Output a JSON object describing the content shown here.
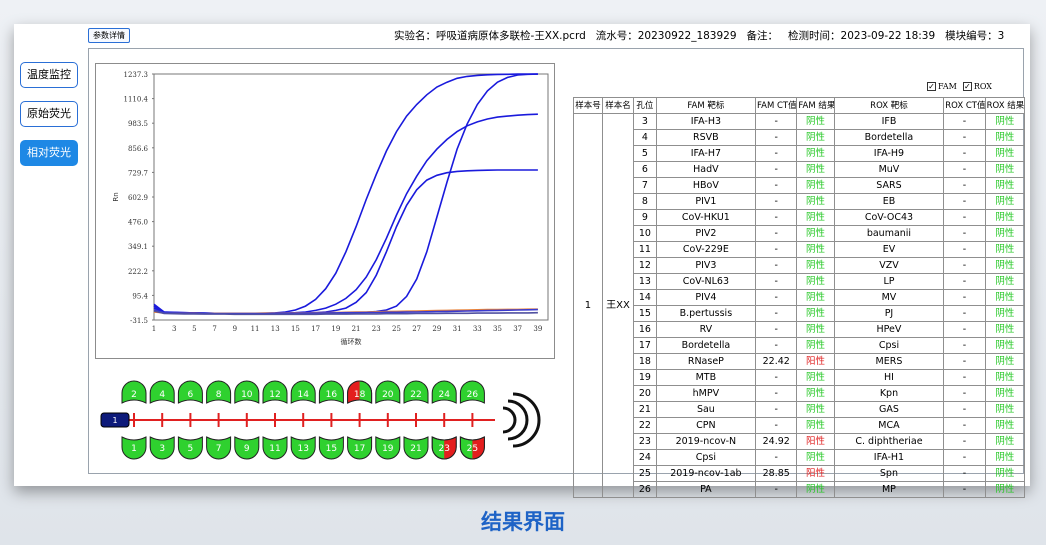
{
  "sidebar": {
    "items": [
      {
        "label": "温度监控",
        "active": false
      },
      {
        "label": "原始荧光",
        "active": false
      },
      {
        "label": "相对荧光",
        "active": true
      }
    ]
  },
  "param_button": "参数详情",
  "header": {
    "experiment": "实验名：呼吸道病原体多联检-王XX.pcrd",
    "serial": "流水号：20230922_183929",
    "note": "备注：",
    "time": "检测时间：2023-09-22 18:39",
    "module": "模块编号：3"
  },
  "checks": [
    {
      "label": "FAM",
      "checked": true
    },
    {
      "label": "ROX",
      "checked": true
    }
  ],
  "chart_data": {
    "type": "line",
    "title": "",
    "xlabel": "循环数",
    "ylabel": "Rn",
    "yticks": [
      "1237.3",
      "1110.4",
      "983.5",
      "856.6",
      "729.7",
      "602.9",
      "476.0",
      "349.1",
      "222.2",
      "95.4",
      "-31.5"
    ],
    "xticks": [
      "1",
      "3",
      "5",
      "7",
      "9",
      "11",
      "13",
      "15",
      "17",
      "19",
      "21",
      "23",
      "25",
      "27",
      "29",
      "31",
      "33",
      "35",
      "37",
      "39"
    ],
    "xlim": [
      1,
      40
    ],
    "ylim": [
      -31.5,
      1237.3
    ],
    "series": [
      {
        "color": "#1a1adc",
        "values": [
          50,
          10,
          8,
          6,
          5,
          4,
          3,
          3,
          2,
          2,
          2,
          3,
          5,
          10,
          20,
          40,
          75,
          130,
          210,
          320,
          450,
          590,
          720,
          840,
          940,
          1020,
          1080,
          1130,
          1170,
          1195,
          1215,
          1225,
          1230,
          1233,
          1235,
          1236,
          1237,
          1237,
          1237
        ]
      },
      {
        "color": "#1a1adc",
        "values": [
          30,
          8,
          6,
          5,
          4,
          3,
          3,
          2,
          2,
          2,
          2,
          2,
          3,
          4,
          6,
          10,
          18,
          30,
          50,
          80,
          125,
          190,
          280,
          390,
          510,
          620,
          710,
          790,
          850,
          900,
          940,
          970,
          990,
          1005,
          1015,
          1020,
          1025,
          1028,
          1030
        ]
      },
      {
        "color": "#1a1adc",
        "values": [
          40,
          8,
          6,
          5,
          4,
          3,
          3,
          2,
          2,
          2,
          2,
          2,
          2,
          3,
          3,
          4,
          6,
          10,
          18,
          30,
          60,
          110,
          200,
          320,
          450,
          560,
          640,
          690,
          715,
          728,
          735,
          738,
          740,
          741,
          742,
          742,
          742,
          742,
          742
        ]
      },
      {
        "color": "#1a1adc",
        "values": [
          40,
          9,
          7,
          6,
          5,
          4,
          3,
          2,
          2,
          2,
          2,
          2,
          2,
          2,
          3,
          3,
          3,
          4,
          4,
          5,
          6,
          8,
          12,
          20,
          40,
          90,
          180,
          320,
          500,
          680,
          850,
          980,
          1080,
          1150,
          1195,
          1220,
          1232,
          1236,
          1237
        ]
      },
      {
        "color": "#e8833a",
        "values": [
          10,
          5,
          4,
          4,
          4,
          3,
          3,
          3,
          3,
          3,
          3,
          4,
          4,
          4,
          5,
          5,
          6,
          6,
          7,
          8,
          9,
          10,
          11,
          12,
          13,
          14,
          15,
          16,
          17,
          18,
          19,
          20,
          21,
          22,
          22,
          23,
          23,
          24,
          24
        ]
      },
      {
        "color": "#3a3ad0",
        "values": [
          20,
          6,
          5,
          4,
          3,
          3,
          2,
          2,
          2,
          2,
          2,
          2,
          3,
          3,
          3,
          4,
          4,
          5,
          5,
          6,
          6,
          7,
          7,
          8,
          8,
          9,
          10,
          11,
          12,
          13,
          14,
          15,
          16,
          17,
          18,
          19,
          20,
          21,
          22
        ]
      },
      {
        "color": "#5050a0",
        "values": [
          15,
          2,
          1,
          0,
          0,
          -1,
          -1,
          -1,
          -2,
          -2,
          -2,
          -2,
          -2,
          -2,
          -2,
          -2,
          -2,
          -1,
          -1,
          -1,
          0,
          0,
          0,
          1,
          1,
          1,
          2,
          2,
          2,
          3,
          3,
          3,
          4,
          4,
          4,
          5,
          5,
          5,
          6
        ]
      }
    ]
  },
  "plate": {
    "strip_label": "1",
    "top_wells": [
      {
        "n": "2",
        "state": "green"
      },
      {
        "n": "4",
        "state": "green"
      },
      {
        "n": "6",
        "state": "green"
      },
      {
        "n": "8",
        "state": "green"
      },
      {
        "n": "10",
        "state": "green"
      },
      {
        "n": "12",
        "state": "green"
      },
      {
        "n": "14",
        "state": "green"
      },
      {
        "n": "16",
        "state": "green"
      },
      {
        "n": "18",
        "state": "red-half"
      },
      {
        "n": "20",
        "state": "green"
      },
      {
        "n": "22",
        "state": "green"
      },
      {
        "n": "24",
        "state": "green"
      },
      {
        "n": "26",
        "state": "green"
      }
    ],
    "bottom_wells": [
      {
        "n": "1",
        "state": "green"
      },
      {
        "n": "3",
        "state": "green"
      },
      {
        "n": "5",
        "state": "green"
      },
      {
        "n": "7",
        "state": "green"
      },
      {
        "n": "9",
        "state": "green"
      },
      {
        "n": "11",
        "state": "green"
      },
      {
        "n": "13",
        "state": "green"
      },
      {
        "n": "15",
        "state": "green"
      },
      {
        "n": "17",
        "state": "green"
      },
      {
        "n": "19",
        "state": "green"
      },
      {
        "n": "21",
        "state": "green"
      },
      {
        "n": "23",
        "state": "red-half"
      },
      {
        "n": "25",
        "state": "red-half"
      }
    ]
  },
  "table": {
    "headers": [
      "样本号",
      "样本名",
      "孔位",
      "FAM 靶标",
      "FAM CT值",
      "FAM 结果",
      "ROX 靶标",
      "ROX CT值",
      "ROX 结果"
    ],
    "sample_no": "1",
    "sample_name": "王XX",
    "rows": [
      {
        "well": "3",
        "fam": "IFA-H3",
        "fam_ct": "-",
        "fam_res": "阴性",
        "rox": "IFB",
        "rox_ct": "-",
        "rox_res": "阴性"
      },
      {
        "well": "4",
        "fam": "RSVB",
        "fam_ct": "-",
        "fam_res": "阴性",
        "rox": "Bordetella",
        "rox_ct": "-",
        "rox_res": "阴性"
      },
      {
        "well": "5",
        "fam": "IFA-H7",
        "fam_ct": "-",
        "fam_res": "阴性",
        "rox": "IFA-H9",
        "rox_ct": "-",
        "rox_res": "阴性"
      },
      {
        "well": "6",
        "fam": "HadV",
        "fam_ct": "-",
        "fam_res": "阴性",
        "rox": "MuV",
        "rox_ct": "-",
        "rox_res": "阴性"
      },
      {
        "well": "7",
        "fam": "HBoV",
        "fam_ct": "-",
        "fam_res": "阴性",
        "rox": "SARS",
        "rox_ct": "-",
        "rox_res": "阴性"
      },
      {
        "well": "8",
        "fam": "PIV1",
        "fam_ct": "-",
        "fam_res": "阴性",
        "rox": "EB",
        "rox_ct": "-",
        "rox_res": "阴性"
      },
      {
        "well": "9",
        "fam": "CoV-HKU1",
        "fam_ct": "-",
        "fam_res": "阴性",
        "rox": "CoV-OC43",
        "rox_ct": "-",
        "rox_res": "阴性"
      },
      {
        "well": "10",
        "fam": "PIV2",
        "fam_ct": "-",
        "fam_res": "阴性",
        "rox": "baumanii",
        "rox_ct": "-",
        "rox_res": "阴性"
      },
      {
        "well": "11",
        "fam": "CoV-229E",
        "fam_ct": "-",
        "fam_res": "阴性",
        "rox": "EV",
        "rox_ct": "-",
        "rox_res": "阴性"
      },
      {
        "well": "12",
        "fam": "PIV3",
        "fam_ct": "-",
        "fam_res": "阴性",
        "rox": "VZV",
        "rox_ct": "-",
        "rox_res": "阴性"
      },
      {
        "well": "13",
        "fam": "CoV-NL63",
        "fam_ct": "-",
        "fam_res": "阴性",
        "rox": "LP",
        "rox_ct": "-",
        "rox_res": "阴性"
      },
      {
        "well": "14",
        "fam": "PIV4",
        "fam_ct": "-",
        "fam_res": "阴性",
        "rox": "MV",
        "rox_ct": "-",
        "rox_res": "阴性"
      },
      {
        "well": "15",
        "fam": "B.pertussis",
        "fam_ct": "-",
        "fam_res": "阴性",
        "rox": "PJ",
        "rox_ct": "-",
        "rox_res": "阴性"
      },
      {
        "well": "16",
        "fam": "RV",
        "fam_ct": "-",
        "fam_res": "阴性",
        "rox": "HPeV",
        "rox_ct": "-",
        "rox_res": "阴性"
      },
      {
        "well": "17",
        "fam": "Bordetella",
        "fam_ct": "-",
        "fam_res": "阴性",
        "rox": "Cpsi",
        "rox_ct": "-",
        "rox_res": "阴性"
      },
      {
        "well": "18",
        "fam": "RNaseP",
        "fam_ct": "22.42",
        "fam_res": "阳性",
        "rox": "MERS",
        "rox_ct": "-",
        "rox_res": "阴性"
      },
      {
        "well": "19",
        "fam": "MTB",
        "fam_ct": "-",
        "fam_res": "阴性",
        "rox": "HI",
        "rox_ct": "-",
        "rox_res": "阴性"
      },
      {
        "well": "20",
        "fam": "hMPV",
        "fam_ct": "-",
        "fam_res": "阴性",
        "rox": "Kpn",
        "rox_ct": "-",
        "rox_res": "阴性"
      },
      {
        "well": "21",
        "fam": "Sau",
        "fam_ct": "-",
        "fam_res": "阴性",
        "rox": "GAS",
        "rox_ct": "-",
        "rox_res": "阴性"
      },
      {
        "well": "22",
        "fam": "CPN",
        "fam_ct": "-",
        "fam_res": "阴性",
        "rox": "MCA",
        "rox_ct": "-",
        "rox_res": "阴性"
      },
      {
        "well": "23",
        "fam": "2019-ncov-N",
        "fam_ct": "24.92",
        "fam_res": "阳性",
        "rox": "C. diphtheriae",
        "rox_ct": "-",
        "rox_res": "阴性"
      },
      {
        "well": "24",
        "fam": "Cpsi",
        "fam_ct": "-",
        "fam_res": "阴性",
        "rox": "IFA-H1",
        "rox_ct": "-",
        "rox_res": "阴性"
      },
      {
        "well": "25",
        "fam": "2019-ncov-1ab",
        "fam_ct": "28.85",
        "fam_res": "阳性",
        "rox": "Spn",
        "rox_ct": "-",
        "rox_res": "阴性"
      },
      {
        "well": "26",
        "fam": "PA",
        "fam_ct": "-",
        "fam_res": "阴性",
        "rox": "MP",
        "rox_ct": "-",
        "rox_res": "阴性"
      }
    ]
  },
  "caption": "结果界面",
  "colors": {
    "accent": "#1e88e5",
    "negative": "#22c722",
    "positive": "#e02020",
    "well_green": "#2fd12f",
    "well_red": "#e41e1e",
    "caption": "#1e63c6"
  }
}
